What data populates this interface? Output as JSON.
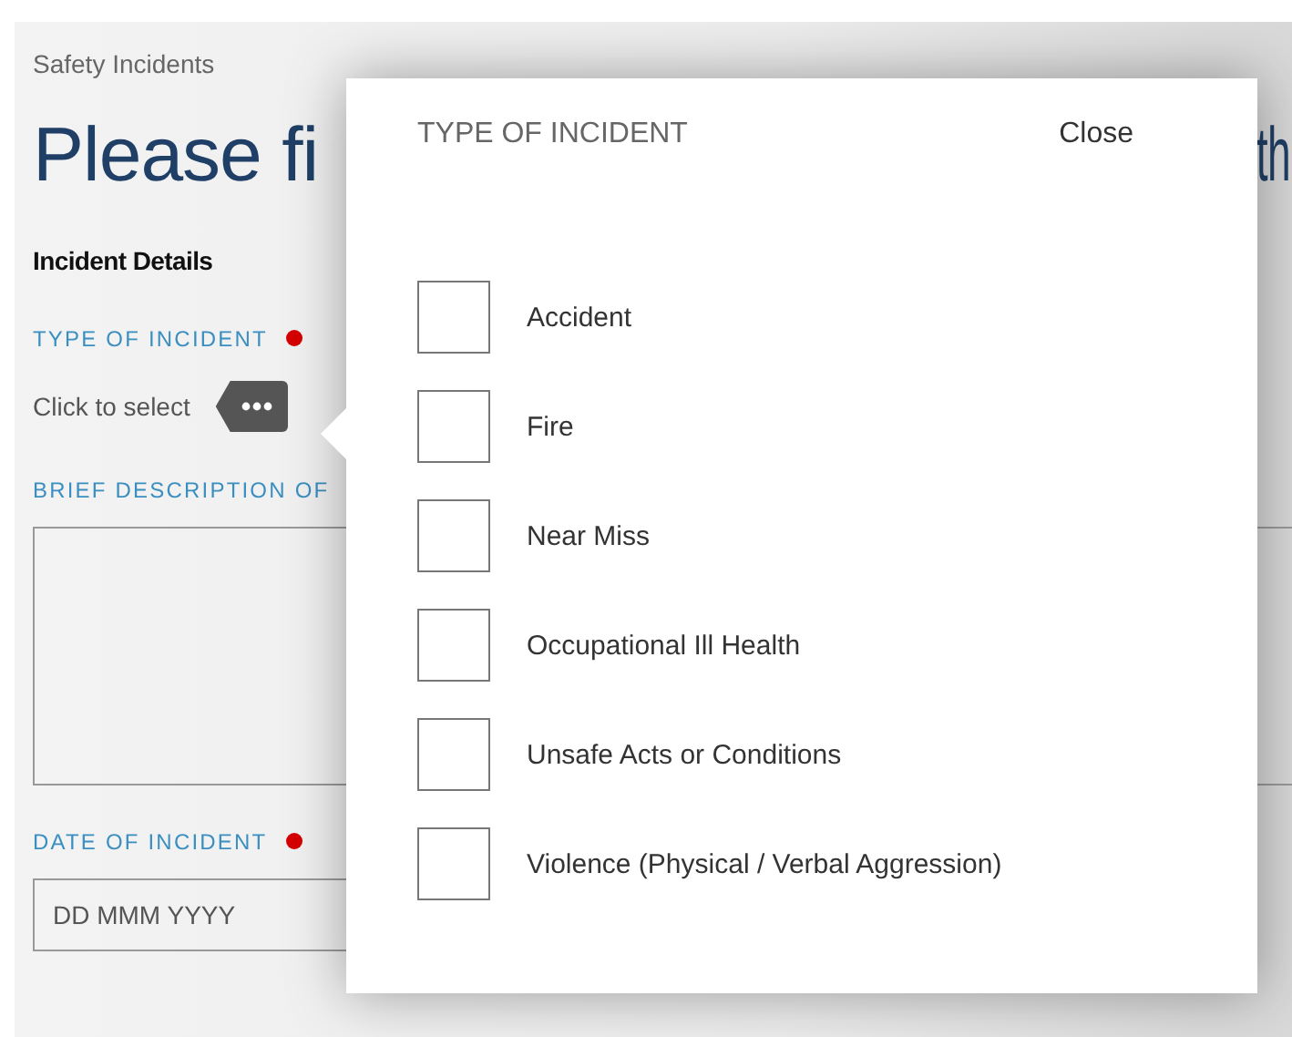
{
  "breadcrumb": "Safety Incidents",
  "heading": {
    "left": "Please fi",
    "right": "th"
  },
  "section_title": "Incident Details",
  "fields": [
    {
      "kind": "select",
      "label": "TYPE OF INCIDENT",
      "required": true,
      "value": "Click to select"
    },
    {
      "kind": "textarea",
      "label": "BRIEF DESCRIPTION OF",
      "required": false
    },
    {
      "kind": "date",
      "label": "DATE OF INCIDENT",
      "required": true,
      "placeholder": "DD MMM YYYY"
    }
  ],
  "popup": {
    "title": "TYPE OF INCIDENT",
    "close": "Close",
    "options": [
      {
        "label": "Accident",
        "checked": false
      },
      {
        "label": "Fire",
        "checked": false
      },
      {
        "label": "Near Miss",
        "checked": false
      },
      {
        "label": "Occupational Ill Health",
        "checked": false
      },
      {
        "label": "Unsafe Acts or Conditions",
        "checked": false
      },
      {
        "label": "Violence (Physical / Verbal Aggression)",
        "checked": false
      }
    ]
  }
}
